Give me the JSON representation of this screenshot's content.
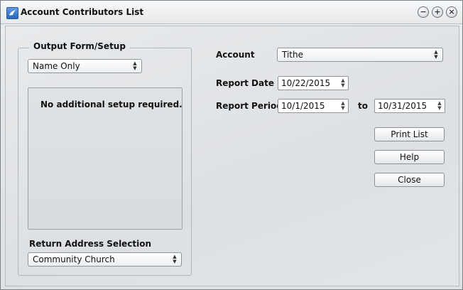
{
  "window": {
    "title": "Account Contributors List",
    "buttons": {
      "minimize": "−",
      "maximize": "+",
      "close": "×"
    }
  },
  "output_form": {
    "legend": "Output Form/Setup",
    "selected": "Name Only",
    "setup_message": "No additional setup required."
  },
  "return_address": {
    "label": "Return Address Selection",
    "selected": "Community Church"
  },
  "account": {
    "label": "Account",
    "selected": "Tithe"
  },
  "report_date": {
    "label": "Report Date",
    "value": "10/22/2015"
  },
  "report_period": {
    "label": "Report Period",
    "from": "10/1/2015",
    "to_label": "to",
    "to": "10/31/2015"
  },
  "actions": {
    "print_label": "Print List",
    "help_label": "Help",
    "close_label": "Close"
  }
}
